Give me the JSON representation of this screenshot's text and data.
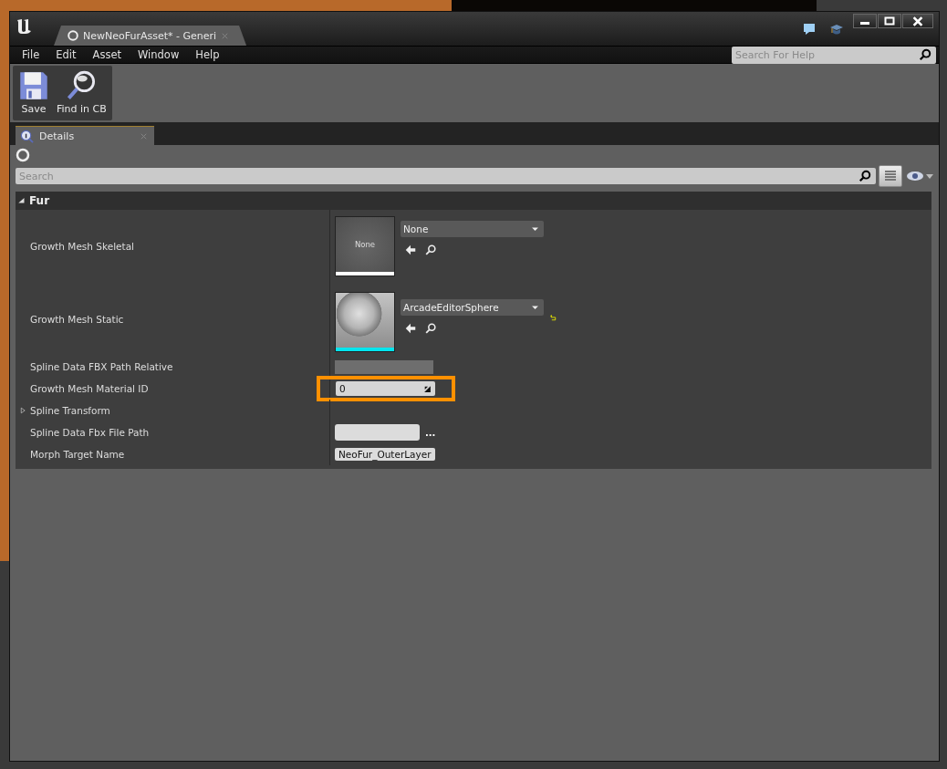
{
  "window": {
    "document_tabs": [
      {
        "label": "NewNeoFurAsset* - Generi",
        "selected": true
      }
    ]
  },
  "menu": [
    "File",
    "Edit",
    "Asset",
    "Window",
    "Help"
  ],
  "help_search": {
    "placeholder": "Search For Help"
  },
  "toolbar": [
    {
      "kind": "save",
      "label": "Save"
    },
    {
      "kind": "find",
      "label": "Find in CB"
    }
  ],
  "panel_tabs": [
    {
      "label": "Details",
      "selected": true
    }
  ],
  "details": {
    "search": {
      "placeholder": "Search"
    },
    "category": {
      "label": "Fur",
      "expanded": true
    },
    "properties": [
      {
        "kind": "asset",
        "label": "Growth Mesh Skeletal",
        "thumbnail_label": "None",
        "color": "#ffffff",
        "value": "None",
        "modified": false
      },
      {
        "kind": "asset",
        "label": "Growth Mesh Static",
        "color": "#00e5ee",
        "value": "ArcadeEditorSphere",
        "modified": true
      },
      {
        "kind": "readonly",
        "label": "Spline Data FBX Path Relative"
      },
      {
        "kind": "number",
        "label": "Growth Mesh Material ID",
        "value": "0",
        "highlighted": true
      },
      {
        "kind": "group",
        "label": "Spline Transform",
        "expanded": false
      },
      {
        "kind": "file",
        "label": "Spline Data Fbx File Path",
        "browse": "..."
      },
      {
        "kind": "name",
        "label": "Morph Target Name",
        "value": "NeoFur_OuterLayer"
      }
    ]
  }
}
